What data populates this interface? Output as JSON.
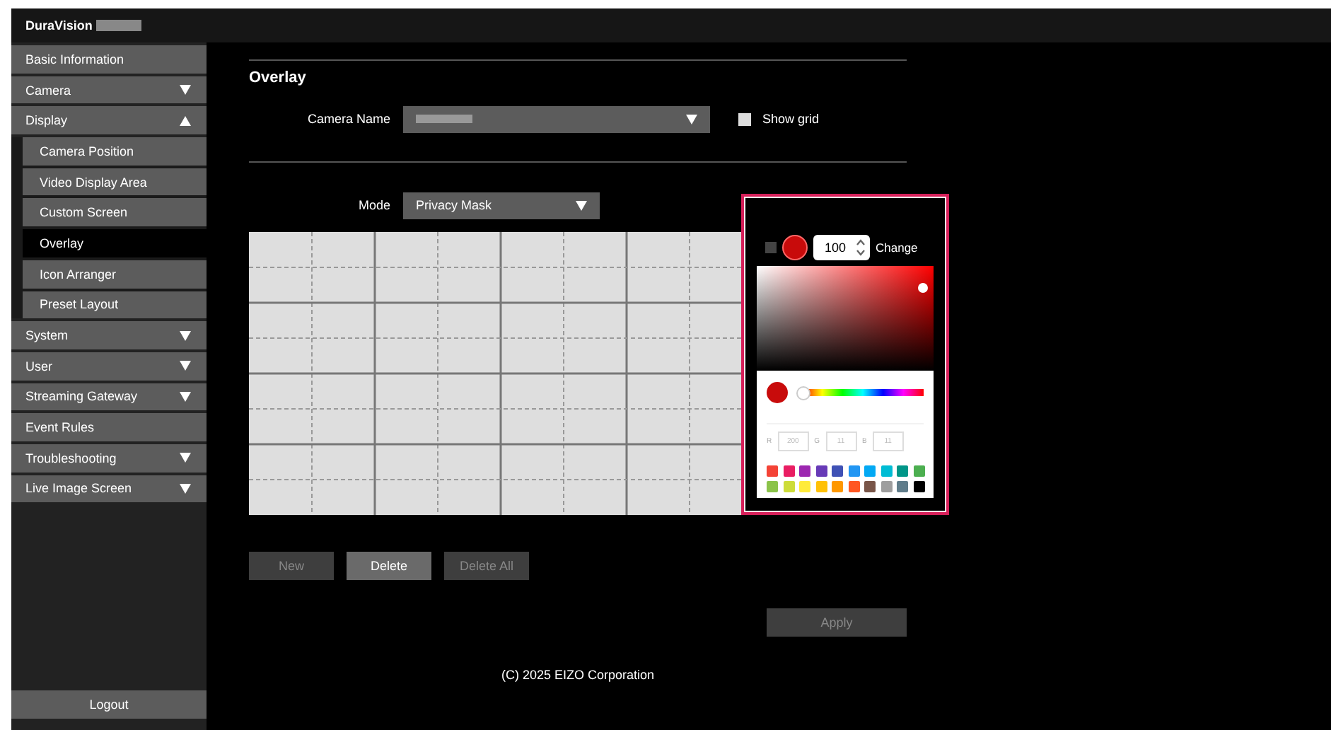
{
  "header": {
    "product": "DuraVision"
  },
  "sidebar": {
    "items": [
      {
        "label": "Basic Information",
        "kind": "link",
        "selected": false
      },
      {
        "label": "Camera",
        "kind": "group",
        "expanded": false,
        "selected": false
      },
      {
        "label": "Display",
        "kind": "group",
        "expanded": true,
        "selected": false,
        "children": [
          {
            "label": "Camera Position",
            "selected": false
          },
          {
            "label": "Video Display Area",
            "selected": false
          },
          {
            "label": "Custom Screen",
            "selected": false
          },
          {
            "label": "Overlay",
            "selected": true
          },
          {
            "label": "Icon Arranger",
            "selected": false
          },
          {
            "label": "Preset Layout",
            "selected": false
          }
        ]
      },
      {
        "label": "System",
        "kind": "group",
        "expanded": false,
        "selected": false
      },
      {
        "label": "User",
        "kind": "group",
        "expanded": false,
        "selected": false
      },
      {
        "label": "Streaming Gateway",
        "kind": "group",
        "expanded": false,
        "selected": false
      },
      {
        "label": "Event Rules",
        "kind": "link",
        "selected": false
      },
      {
        "label": "Troubleshooting",
        "kind": "group",
        "expanded": false,
        "selected": false
      },
      {
        "label": "Live Image Screen",
        "kind": "group",
        "expanded": false,
        "selected": false
      }
    ],
    "logout": "Logout"
  },
  "page": {
    "title": "Overlay",
    "camera_name": {
      "label": "Camera Name"
    },
    "show_grid": {
      "label": "Show grid",
      "checked": false
    },
    "mode": {
      "label": "Mode",
      "value": "Privacy Mask"
    },
    "buttons": [
      {
        "label": "New",
        "disabled": true
      },
      {
        "label": "Delete",
        "disabled": false
      },
      {
        "label": "Delete All",
        "disabled": true
      }
    ],
    "apply": {
      "label": "Apply",
      "disabled": true
    }
  },
  "color_picker": {
    "color": "#c80b0b",
    "opacity": "100",
    "change_label": "Change",
    "hue": {
      "level": 0
    },
    "channels": [
      {
        "label": "R",
        "placeholder": "200"
      },
      {
        "label": "G",
        "placeholder": "11"
      },
      {
        "label": "B",
        "placeholder": "11"
      }
    ],
    "swatches": [
      {
        "color": "#f44336"
      },
      {
        "color": "#e91e63"
      },
      {
        "color": "#9c27b0"
      },
      {
        "color": "#673ab7"
      },
      {
        "color": "#3f51b5"
      },
      {
        "color": "#2196f3"
      },
      {
        "color": "#03a9f4"
      },
      {
        "color": "#00bcd4"
      },
      {
        "color": "#009688"
      },
      {
        "color": "#4caf50"
      },
      {
        "color": "#8bc34a"
      },
      {
        "color": "#cddc39"
      },
      {
        "color": "#ffeb3b"
      },
      {
        "color": "#ffc107"
      },
      {
        "color": "#ff9800"
      },
      {
        "color": "#ff5722"
      },
      {
        "color": "#795548"
      },
      {
        "color": "#9e9e9e"
      },
      {
        "color": "#607d8b"
      },
      {
        "color": "#000000"
      }
    ]
  },
  "footer": "(C) 2025 EIZO Corporation"
}
